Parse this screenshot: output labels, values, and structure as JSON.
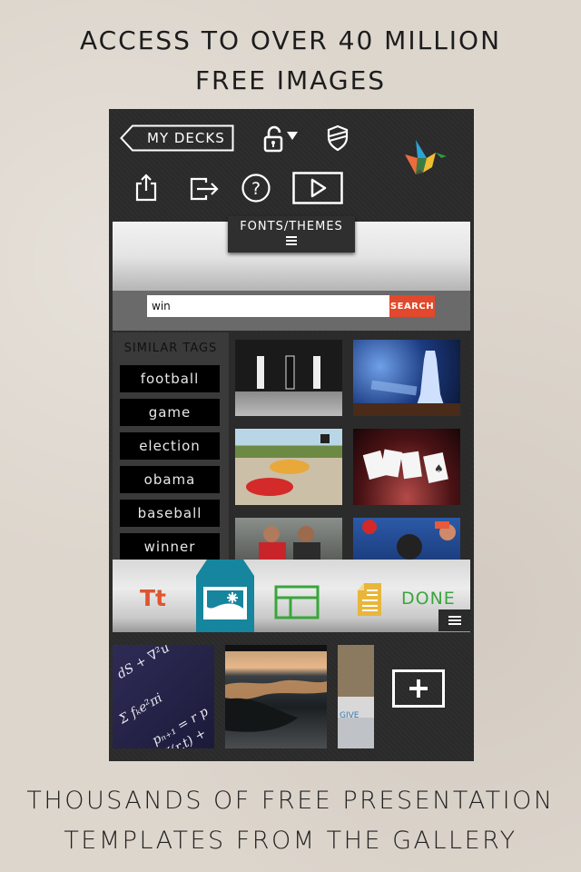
{
  "headline": {
    "line1": "ACCESS TO OVER 40 MILLION",
    "line2": "FREE IMAGES"
  },
  "footer": {
    "line1": "THOUSANDS OF FREE PRESENTATION",
    "line2": "TEMPLATES FROM THE GALLERY"
  },
  "toolbar": {
    "back_label": "MY DECKS",
    "icons": [
      "unlock-icon",
      "dropdown-arrow-icon",
      "shield-icon",
      "share-icon",
      "export-icon",
      "help-icon",
      "play-icon",
      "origami-bird-logo"
    ]
  },
  "theme_tab": {
    "label": "FONTS/THEMES"
  },
  "search": {
    "value": "win",
    "button_label": "SEARCH"
  },
  "tags": {
    "title": "SIMILAR TAGS",
    "items": [
      "football",
      "game",
      "election",
      "obama",
      "baseball",
      "winner"
    ]
  },
  "results": [
    {
      "name": "karate-match"
    },
    {
      "name": "chess-king"
    },
    {
      "name": "kids-car-race"
    },
    {
      "name": "aces-cards"
    },
    {
      "name": "celebrating-fans"
    },
    {
      "name": "crowd-cheering"
    }
  ],
  "bottom_tools": {
    "text_label": "Tt",
    "done_label": "DONE"
  },
  "colors": {
    "accent_orange": "#e2482b",
    "teal": "#16859e",
    "green": "#39a63c",
    "yellow": "#e8b63a"
  }
}
